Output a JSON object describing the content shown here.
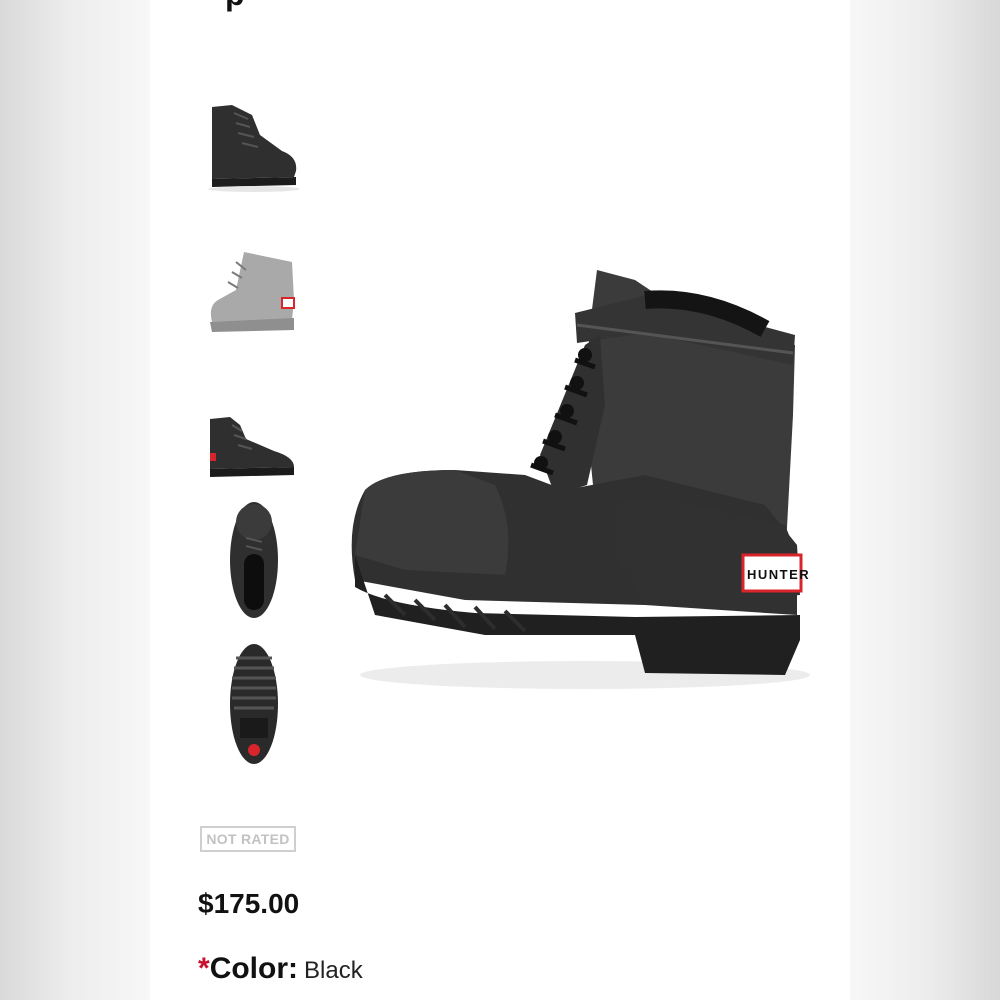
{
  "product": {
    "title_fragment": "p",
    "rating_badge": "NOT RATED",
    "price": "$175.00",
    "color": {
      "required_marker": "*",
      "label": "Color:",
      "value": "Black"
    },
    "hero_logo_text": "HUNTER"
  },
  "gallery": {
    "thumbnails": [
      {
        "view": "side-front",
        "icon": "boot-side-icon"
      },
      {
        "view": "rear-quarter-grey",
        "icon": "boot-rear-icon"
      },
      {
        "view": "side-low",
        "icon": "boot-side-icon"
      },
      {
        "view": "top-down",
        "icon": "boot-top-icon"
      },
      {
        "view": "sole",
        "icon": "boot-sole-icon"
      }
    ]
  },
  "colors": {
    "boot": "#2e2f2e",
    "boot_highlight": "#474847",
    "price_text": "#111111",
    "required": "#c8102e",
    "badge_border": "#cfcfcf",
    "logo_red": "#d8242b"
  }
}
